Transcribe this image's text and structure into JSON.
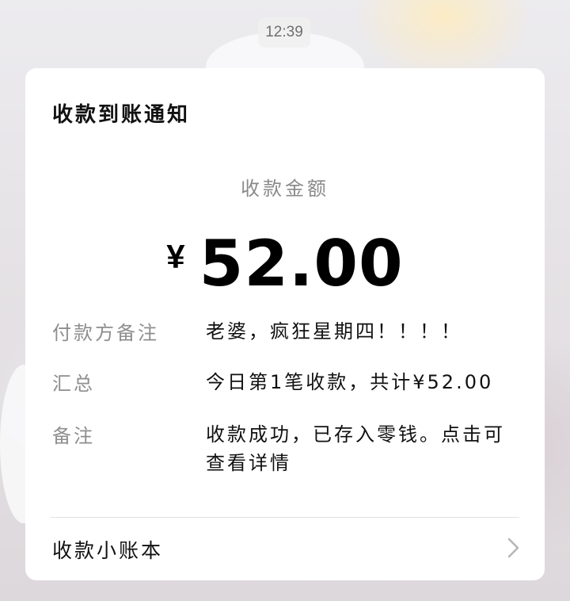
{
  "chat": {
    "timestamp": "12:39"
  },
  "card": {
    "title": "收款到账通知",
    "amount_label": "收款金额",
    "currency_symbol": "¥",
    "amount": "52.00",
    "details": [
      {
        "key": "付款方备注",
        "value": "老婆，疯狂星期四！！！！"
      },
      {
        "key": "汇总",
        "value": "今日第1笔收款，共计¥52.00"
      },
      {
        "key": "备注",
        "value": "收款成功，已存入零钱。点击可查看详情"
      }
    ],
    "ledger_link": "收款小账本",
    "icons": {
      "ledger_arrow": "chevron-right-icon"
    },
    "colors": {
      "label_gray": "#8e8e8e",
      "text_dark": "#111111",
      "card_bg": "#ffffff"
    }
  }
}
